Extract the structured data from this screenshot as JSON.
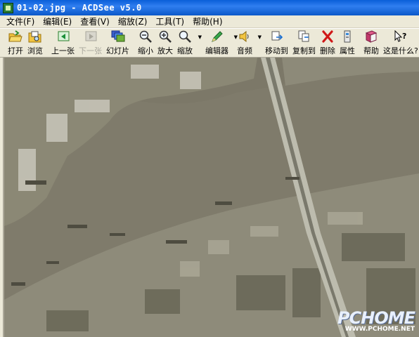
{
  "window": {
    "title": "01-02.jpg - ACDSee v5.0"
  },
  "menu": [
    {
      "label": "文件(F)"
    },
    {
      "label": "编辑(E)"
    },
    {
      "label": "查看(V)"
    },
    {
      "label": "缩放(Z)"
    },
    {
      "label": "工具(T)"
    },
    {
      "label": "帮助(H)"
    }
  ],
  "toolbar": {
    "open": "打开",
    "browse": "浏览",
    "prev": "上一张",
    "next": "下一张",
    "slideshow": "幻灯片",
    "zoom_out": "缩小",
    "zoom_in": "放大",
    "zoom": "缩放",
    "editor": "编辑器",
    "audio": "音频",
    "move_to": "移动到",
    "copy_to": "复制到",
    "delete": "删除",
    "properties": "属性",
    "help": "帮助",
    "whats_this": "这是什么?"
  },
  "watermark": {
    "logo": "PCHOME",
    "url": "WWW.PCHOME.NET"
  },
  "icons": {
    "open": "folder-open-icon",
    "browse": "browse-icon",
    "prev": "previous-icon",
    "next": "next-icon",
    "slideshow": "slideshow-icon",
    "zoom_out": "zoom-out-icon",
    "zoom_in": "zoom-in-icon",
    "zoom": "zoom-icon",
    "editor": "editor-icon",
    "audio": "speaker-icon",
    "move_to": "move-to-icon",
    "copy_to": "copy-to-icon",
    "delete": "delete-icon",
    "properties": "properties-icon",
    "help": "help-book-icon",
    "whats_this": "whats-this-icon"
  },
  "colors": {
    "titlebar": "#0a5fd8",
    "river": "#7b7767",
    "land": "#8e8b78",
    "chrome": "#ece9d8"
  }
}
